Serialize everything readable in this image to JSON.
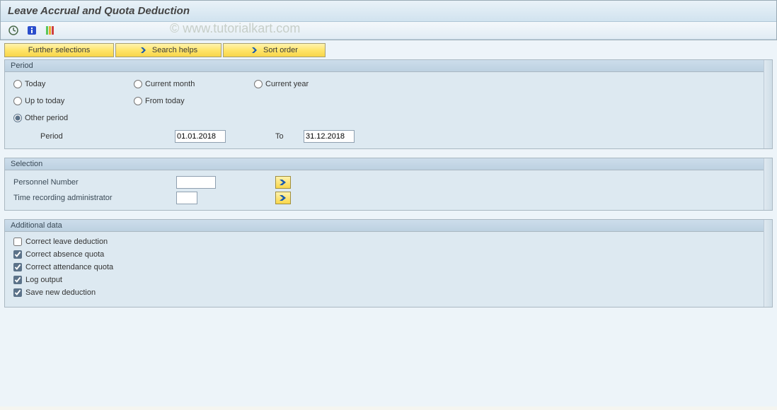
{
  "title": "Leave Accrual and Quota Deduction",
  "watermark": "© www.tutorialkart.com",
  "buttons": {
    "further_selections": "Further selections",
    "search_helps": "Search helps",
    "sort_order": "Sort order"
  },
  "period_panel": {
    "title": "Period",
    "options": {
      "today": "Today",
      "up_to_today": "Up to today",
      "other_period": "Other period",
      "current_month": "Current month",
      "from_today": "From today",
      "current_year": "Current year"
    },
    "selected": "other_period",
    "period_label": "Period",
    "period_from": "01.01.2018",
    "period_to_label": "To",
    "period_to": "31.12.2018"
  },
  "selection_panel": {
    "title": "Selection",
    "personnel_number_label": "Personnel Number",
    "personnel_number": "",
    "time_admin_label": "Time recording administrator",
    "time_admin": ""
  },
  "additional_panel": {
    "title": "Additional data",
    "items": [
      {
        "label": "Correct leave deduction",
        "checked": false
      },
      {
        "label": "Correct absence quota",
        "checked": true
      },
      {
        "label": "Correct attendance quota",
        "checked": true
      },
      {
        "label": "Log output",
        "checked": true
      },
      {
        "label": "Save new deduction",
        "checked": true
      }
    ]
  }
}
